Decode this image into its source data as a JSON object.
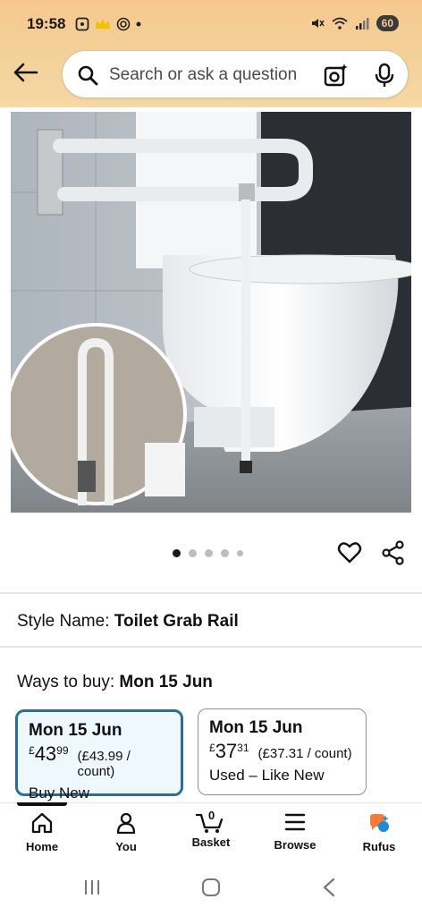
{
  "status_bar": {
    "time": "19:58",
    "battery": "60"
  },
  "search": {
    "placeholder": "Search or ask a question"
  },
  "gallery": {
    "dot_count": 5,
    "active_index": 0
  },
  "style": {
    "label": "Style Name:",
    "value": "Toilet Grab Rail"
  },
  "ways_to_buy": {
    "label": "Ways to buy:",
    "date": "Mon 15 Jun"
  },
  "options": [
    {
      "date": "Mon 15 Jun",
      "currency": "£",
      "whole": "43",
      "fraction": "99",
      "unit_price": "(£43.99 / count)",
      "condition": "Buy New"
    },
    {
      "date": "Mon 15 Jun",
      "currency": "£",
      "whole": "37",
      "fraction": "31",
      "unit_price": "(£37.31 / count)",
      "condition": "Used – Like New"
    }
  ],
  "nav": {
    "home": "Home",
    "you": "You",
    "basket": "Basket",
    "basket_count": "0",
    "browse": "Browse",
    "rufus": "Rufus"
  },
  "colors": {
    "header_accent": "#f6c88f",
    "selected_border": "#2d6d9a",
    "rufus_orange": "#f27c3a",
    "rufus_blue": "#1a8cd8"
  }
}
